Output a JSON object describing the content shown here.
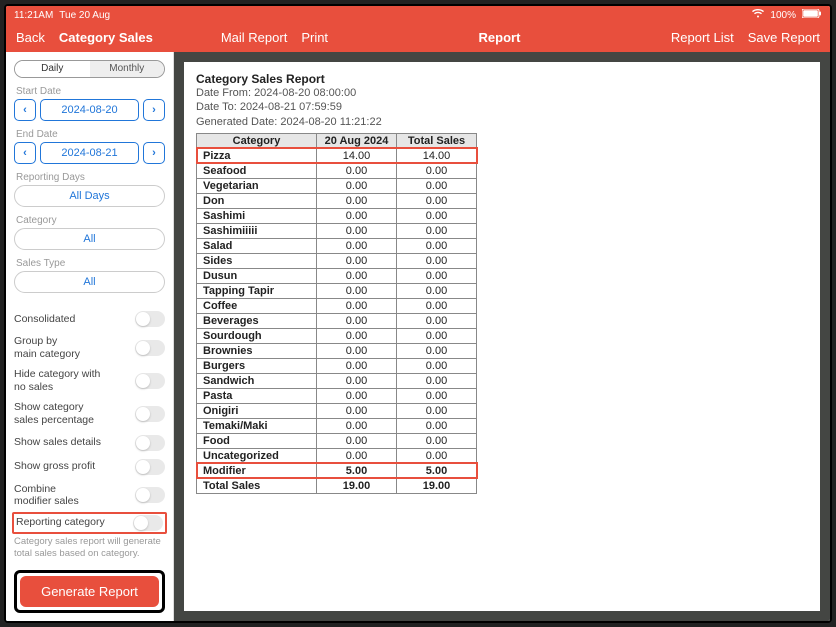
{
  "status": {
    "time": "11:21AM",
    "date": "Tue 20 Aug",
    "wifi_icon": "wifi-icon",
    "battery_pct": "100%",
    "battery_icon": "battery-icon"
  },
  "nav": {
    "back": "Back",
    "screen_title": "Category Sales",
    "mail_report": "Mail Report",
    "print": "Print",
    "center": "Report",
    "report_list": "Report List",
    "save_report": "Save Report"
  },
  "sidebar": {
    "seg": {
      "daily": "Daily",
      "monthly": "Monthly"
    },
    "start_label": "Start Date",
    "start_date": "2024-08-20",
    "end_label": "End Date",
    "end_date": "2024-08-21",
    "reporting_days_label": "Reporting Days",
    "reporting_days_value": "All Days",
    "category_label": "Category",
    "category_value": "All",
    "sales_type_label": "Sales Type",
    "sales_type_value": "All",
    "toggles": {
      "consolidated": "Consolidated",
      "group_by": "Group by\nmain category",
      "hide_nosales": "Hide category with\nno sales",
      "show_pct": "Show category\nsales percentage",
      "show_details": "Show sales details",
      "gross_profit": "Show gross profit",
      "combine_modifier": "Combine\nmodifier sales",
      "reporting_category": "Reporting category"
    },
    "help": "Category sales report will generate total sales based on category.",
    "generate": "Generate Report"
  },
  "report": {
    "title": "Category Sales Report",
    "date_from": "Date From: 2024-08-20 08:00:00",
    "date_to": "Date To: 2024-08-21 07:59:59",
    "generated": "Generated Date: 2024-08-20 11:21:22",
    "headers": [
      "Category",
      "20 Aug 2024",
      "Total Sales"
    ],
    "rows": [
      {
        "cat": "Pizza",
        "col1": "14.00",
        "col2": "14.00",
        "hl": true
      },
      {
        "cat": "Seafood",
        "col1": "0.00",
        "col2": "0.00"
      },
      {
        "cat": "Vegetarian",
        "col1": "0.00",
        "col2": "0.00"
      },
      {
        "cat": "Don",
        "col1": "0.00",
        "col2": "0.00"
      },
      {
        "cat": "Sashimi",
        "col1": "0.00",
        "col2": "0.00"
      },
      {
        "cat": "Sashimiiiii",
        "col1": "0.00",
        "col2": "0.00"
      },
      {
        "cat": "Salad",
        "col1": "0.00",
        "col2": "0.00"
      },
      {
        "cat": "Sides",
        "col1": "0.00",
        "col2": "0.00"
      },
      {
        "cat": "Dusun",
        "col1": "0.00",
        "col2": "0.00"
      },
      {
        "cat": "Tapping Tapir",
        "col1": "0.00",
        "col2": "0.00"
      },
      {
        "cat": "Coffee",
        "col1": "0.00",
        "col2": "0.00"
      },
      {
        "cat": "Beverages",
        "col1": "0.00",
        "col2": "0.00"
      },
      {
        "cat": "Sourdough",
        "col1": "0.00",
        "col2": "0.00"
      },
      {
        "cat": "Brownies",
        "col1": "0.00",
        "col2": "0.00"
      },
      {
        "cat": "Burgers",
        "col1": "0.00",
        "col2": "0.00"
      },
      {
        "cat": "Sandwich",
        "col1": "0.00",
        "col2": "0.00"
      },
      {
        "cat": "Pasta",
        "col1": "0.00",
        "col2": "0.00"
      },
      {
        "cat": "Onigiri",
        "col1": "0.00",
        "col2": "0.00"
      },
      {
        "cat": "Temaki/Maki",
        "col1": "0.00",
        "col2": "0.00"
      },
      {
        "cat": "Food",
        "col1": "0.00",
        "col2": "0.00"
      },
      {
        "cat": "Uncategorized",
        "col1": "0.00",
        "col2": "0.00"
      },
      {
        "cat": "Modifier",
        "col1": "5.00",
        "col2": "5.00",
        "hl": true,
        "bold": true
      }
    ],
    "total": {
      "cat": "Total Sales",
      "col1": "19.00",
      "col2": "19.00"
    }
  }
}
